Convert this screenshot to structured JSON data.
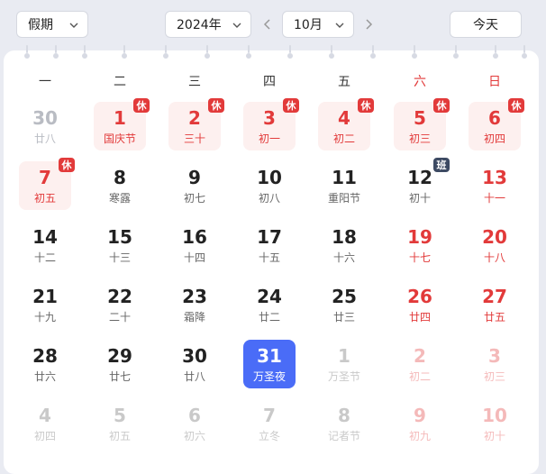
{
  "toolbar": {
    "holiday_select": "假期",
    "year_select": "2024年",
    "month_select": "10月",
    "today_button": "今天"
  },
  "weekdays": [
    "一",
    "二",
    "三",
    "四",
    "五",
    "六",
    "日"
  ],
  "days": [
    {
      "n": "30",
      "l": "廿八",
      "k": "gray"
    },
    {
      "n": "1",
      "l": "国庆节",
      "k": "rest",
      "b": "休"
    },
    {
      "n": "2",
      "l": "三十",
      "k": "rest",
      "b": "休"
    },
    {
      "n": "3",
      "l": "初一",
      "k": "rest",
      "b": "休"
    },
    {
      "n": "4",
      "l": "初二",
      "k": "rest",
      "b": "休"
    },
    {
      "n": "5",
      "l": "初三",
      "k": "rest",
      "b": "休"
    },
    {
      "n": "6",
      "l": "初四",
      "k": "rest",
      "b": "休"
    },
    {
      "n": "7",
      "l": "初五",
      "k": "rest",
      "b": "休"
    },
    {
      "n": "8",
      "l": "寒露",
      "k": ""
    },
    {
      "n": "9",
      "l": "初七",
      "k": ""
    },
    {
      "n": "10",
      "l": "初八",
      "k": ""
    },
    {
      "n": "11",
      "l": "重阳节",
      "k": ""
    },
    {
      "n": "12",
      "l": "初十",
      "k": "",
      "b": "班",
      "bw": true
    },
    {
      "n": "13",
      "l": "十一",
      "k": "red"
    },
    {
      "n": "14",
      "l": "十二",
      "k": ""
    },
    {
      "n": "15",
      "l": "十三",
      "k": ""
    },
    {
      "n": "16",
      "l": "十四",
      "k": ""
    },
    {
      "n": "17",
      "l": "十五",
      "k": ""
    },
    {
      "n": "18",
      "l": "十六",
      "k": ""
    },
    {
      "n": "19",
      "l": "十七",
      "k": "red"
    },
    {
      "n": "20",
      "l": "十八",
      "k": "red"
    },
    {
      "n": "21",
      "l": "十九",
      "k": ""
    },
    {
      "n": "22",
      "l": "二十",
      "k": ""
    },
    {
      "n": "23",
      "l": "霜降",
      "k": ""
    },
    {
      "n": "24",
      "l": "廿二",
      "k": ""
    },
    {
      "n": "25",
      "l": "廿三",
      "k": ""
    },
    {
      "n": "26",
      "l": "廿四",
      "k": "red"
    },
    {
      "n": "27",
      "l": "廿五",
      "k": "red"
    },
    {
      "n": "28",
      "l": "廿六",
      "k": ""
    },
    {
      "n": "29",
      "l": "廿七",
      "k": ""
    },
    {
      "n": "30",
      "l": "廿八",
      "k": ""
    },
    {
      "n": "31",
      "l": "万圣夜",
      "k": "today"
    },
    {
      "n": "1",
      "l": "万圣节",
      "k": "other"
    },
    {
      "n": "2",
      "l": "初二",
      "k": "other red"
    },
    {
      "n": "3",
      "l": "初三",
      "k": "other red"
    },
    {
      "n": "4",
      "l": "初四",
      "k": "other"
    },
    {
      "n": "5",
      "l": "初五",
      "k": "other"
    },
    {
      "n": "6",
      "l": "初六",
      "k": "other"
    },
    {
      "n": "7",
      "l": "立冬",
      "k": "other"
    },
    {
      "n": "8",
      "l": "记者节",
      "k": "other"
    },
    {
      "n": "9",
      "l": "初九",
      "k": "other red"
    },
    {
      "n": "10",
      "l": "初十",
      "k": "other red"
    }
  ],
  "colors": {
    "accent": "#4a6cf7",
    "holiday_red": "#e23a3a",
    "work_badge": "#3d4a63"
  },
  "icons": {
    "dropdown": "chevron-down-icon",
    "prev": "chevron-left-icon",
    "next": "chevron-right-icon"
  }
}
